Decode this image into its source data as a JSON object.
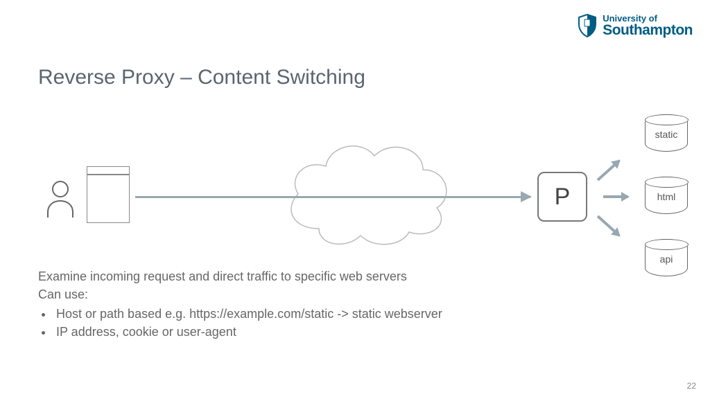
{
  "logo": {
    "line1": "University of",
    "line2": "Southampton"
  },
  "title": "Reverse Proxy – Content Switching",
  "proxy_label": "P",
  "servers": {
    "static": "static",
    "html": "html",
    "api": "api"
  },
  "body": {
    "line1": "Examine incoming request and direct traffic to specific web servers",
    "line2": "Can use:",
    "bullet1": "Host or path based e.g. https://example.com/static -> static webserver",
    "bullet2": "IP address, cookie or user-agent"
  },
  "page_number": "22"
}
